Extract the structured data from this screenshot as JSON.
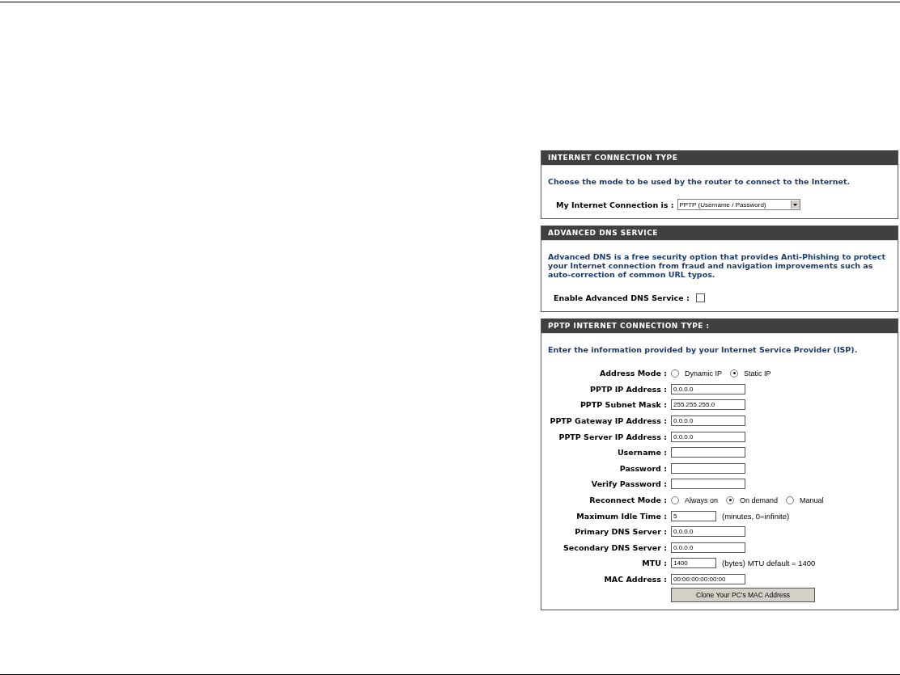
{
  "panels": [
    {
      "title": "INTERNET CONNECTION TYPE",
      "description": "Choose the mode to be used by the router to connect to the Internet.",
      "rows": [
        {
          "kind": "select",
          "label": "My Internet Connection is :",
          "value": "PPTP (Username / Password)"
        }
      ]
    },
    {
      "title": "ADVANCED DNS SERVICE",
      "description": "Advanced DNS is a free security option that provides Anti-Phishing to protect your Internet connection from fraud and navigation improvements such as auto-correction of common URL typos.",
      "rows": [
        {
          "kind": "checkbox",
          "label": "Enable Advanced DNS Service :",
          "checked": false
        }
      ]
    },
    {
      "title": "PPTP INTERNET CONNECTION TYPE :",
      "description": "Enter the information provided by your Internet Service Provider (ISP).",
      "rows": [
        {
          "kind": "radio",
          "label": "Address Mode :",
          "options": [
            {
              "label": "Dynamic IP",
              "selected": false
            },
            {
              "label": "Static IP",
              "selected": true
            }
          ]
        },
        {
          "kind": "text",
          "label": "PPTP IP Address :",
          "value": "0.0.0.0"
        },
        {
          "kind": "text",
          "label": "PPTP Subnet Mask :",
          "value": "255.255.255.0"
        },
        {
          "kind": "text",
          "label": "PPTP Gateway IP Address :",
          "value": "0.0.0.0"
        },
        {
          "kind": "text",
          "label": "PPTP Server IP Address :",
          "value": "0.0.0.0"
        },
        {
          "kind": "text",
          "label": "Username :"
        },
        {
          "kind": "text",
          "label": "Password :"
        },
        {
          "kind": "text",
          "label": "Verify Password :"
        },
        {
          "kind": "radio",
          "label": "Reconnect Mode :",
          "options": [
            {
              "label": "Always on",
              "selected": false
            },
            {
              "label": "On demand",
              "selected": true
            },
            {
              "label": "Manual",
              "selected": false
            }
          ]
        },
        {
          "kind": "short-text",
          "label": "Maximum Idle Time :",
          "value": "5",
          "suffix": "(minutes, 0=infinite)"
        },
        {
          "kind": "text",
          "label": "Primary DNS Server :",
          "value": "0.0.0.0"
        },
        {
          "kind": "text",
          "label": "Secondary DNS Server :",
          "value": "0.0.0.0"
        },
        {
          "kind": "short-text",
          "label": "MTU :",
          "value": "1400",
          "suffix": "(bytes) MTU default = 1400"
        },
        {
          "kind": "text",
          "label": "MAC Address :",
          "value": "00:00:00:00:00:00"
        },
        {
          "kind": "button",
          "label": "Clone Your PC's MAC Address"
        }
      ]
    }
  ]
}
